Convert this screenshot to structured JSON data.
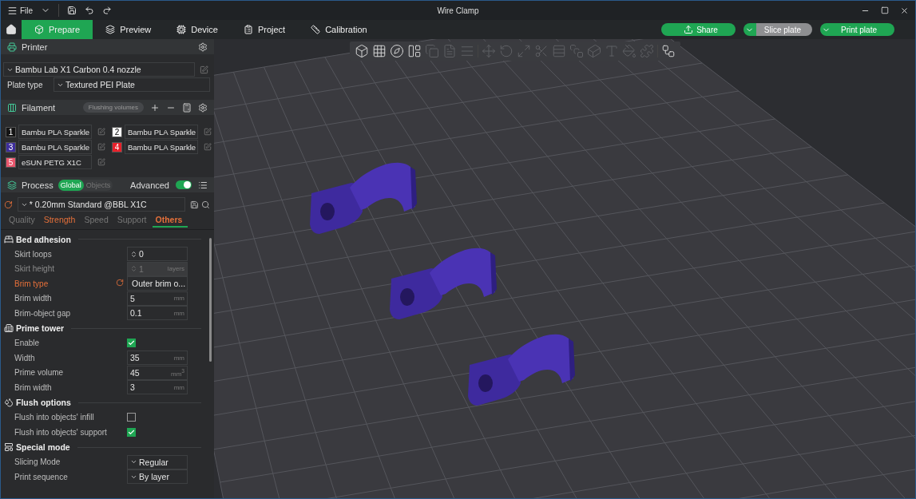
{
  "window": {
    "menu": "File",
    "title": "Wire Clamp"
  },
  "tabs": [
    {
      "label": "Prepare",
      "selected": true
    },
    {
      "label": "Preview",
      "selected": false
    },
    {
      "label": "Device",
      "selected": false
    },
    {
      "label": "Project",
      "selected": false
    },
    {
      "label": "Calibration",
      "selected": false
    }
  ],
  "actions": [
    {
      "kind": "share",
      "label": "Share",
      "disabled": false
    },
    {
      "kind": "split",
      "label": "Slice plate",
      "disabled": true
    },
    {
      "kind": "split",
      "label": "Print plate",
      "disabled": false
    }
  ],
  "printer": {
    "title": "Printer",
    "model": "Bambu Lab X1 Carbon 0.4 nozzle",
    "plate_label": "Plate type",
    "plate": "Textured PEI Plate"
  },
  "filament": {
    "title": "Filament",
    "flushing": "Flushing volumes",
    "items": [
      {
        "number": "1",
        "color": "#141414",
        "name": "Bambu PLA Sparkle"
      },
      {
        "number": "2",
        "color": "#ffffff",
        "name": "Bambu PLA Sparkle"
      },
      {
        "number": "3",
        "color": "#3d2d9c",
        "name": "Bambu PLA Sparkle"
      },
      {
        "number": "4",
        "color": "#e8202a",
        "name": "Bambu PLA Sparkle"
      },
      {
        "number": "5",
        "color": "#e9566c",
        "name": "eSUN PETG X1C"
      }
    ]
  },
  "process": {
    "title": "Process",
    "scopes": [
      {
        "label": "Global",
        "selected": true
      },
      {
        "label": "Objects",
        "selected": false
      }
    ],
    "advanced_label": "Advanced",
    "advanced": true,
    "preset": "* 0.20mm Standard @BBL X1C",
    "tabs": [
      {
        "label": "Quality",
        "selected": false,
        "modified": false
      },
      {
        "label": "Strength",
        "selected": false,
        "modified": true
      },
      {
        "label": "Speed",
        "selected": false,
        "modified": false
      },
      {
        "label": "Support",
        "selected": false,
        "modified": false
      },
      {
        "label": "Others",
        "selected": true,
        "modified": false
      }
    ]
  },
  "groups": [
    {
      "title": "Bed adhesion",
      "rows": [
        {
          "kind": "spin",
          "label": "Skirt loops",
          "value": "0",
          "disabled": false,
          "modified": false
        },
        {
          "kind": "spin",
          "label": "Skirt height",
          "value": "1",
          "unit": "layers",
          "disabled": true,
          "modified": false
        },
        {
          "kind": "select",
          "label": "Brim type",
          "value": "Outer brim o...",
          "disabled": false,
          "modified": true
        },
        {
          "kind": "number",
          "label": "Brim width",
          "value": "5",
          "unit": "mm",
          "disabled": false,
          "modified": false
        },
        {
          "kind": "number",
          "label": "Brim-object gap",
          "value": "0.1",
          "unit": "mm",
          "disabled": false,
          "modified": false
        }
      ]
    },
    {
      "title": "Prime tower",
      "rows": [
        {
          "kind": "checkbox",
          "label": "Enable",
          "checked": true,
          "disabled": false,
          "modified": false
        },
        {
          "kind": "number",
          "label": "Width",
          "value": "35",
          "unit": "mm",
          "disabled": false,
          "modified": false
        },
        {
          "kind": "number",
          "label": "Prime volume",
          "value": "45",
          "unit": "mm$^{3}$",
          "disabled": false,
          "modified": false
        },
        {
          "kind": "number",
          "label": "Brim width",
          "value": "3",
          "unit": "mm",
          "disabled": false,
          "modified": false
        }
      ]
    },
    {
      "title": "Flush options",
      "rows": [
        {
          "kind": "checkbox",
          "label": "Flush into objects' infill",
          "checked": false,
          "disabled": false,
          "modified": false
        },
        {
          "kind": "checkbox",
          "label": "Flush into objects' support",
          "checked": true,
          "disabled": false,
          "modified": false
        }
      ]
    },
    {
      "title": "Special mode",
      "rows": [
        {
          "kind": "select",
          "label": "Slicing Mode",
          "value": "Regular",
          "disabled": false,
          "modified": false
        },
        {
          "kind": "select",
          "label": "Print sequence",
          "value": "By layer",
          "disabled": false,
          "modified": false
        }
      ]
    }
  ],
  "toolbar": [
    [
      {
        "disabled": false
      },
      {
        "disabled": false
      },
      {
        "disabled": false
      },
      {
        "disabled": false
      },
      {
        "disabled": true
      },
      {
        "disabled": true
      },
      {
        "disabled": true
      }
    ],
    [
      {
        "disabled": true
      },
      {
        "disabled": true
      },
      {
        "disabled": true
      },
      {
        "disabled": true
      },
      {
        "disabled": true
      },
      {
        "disabled": true
      },
      {
        "disabled": true
      },
      {
        "disabled": true
      },
      {
        "disabled": true
      },
      {
        "disabled": true
      }
    ],
    [
      {
        "disabled": false
      }
    ]
  ]
}
